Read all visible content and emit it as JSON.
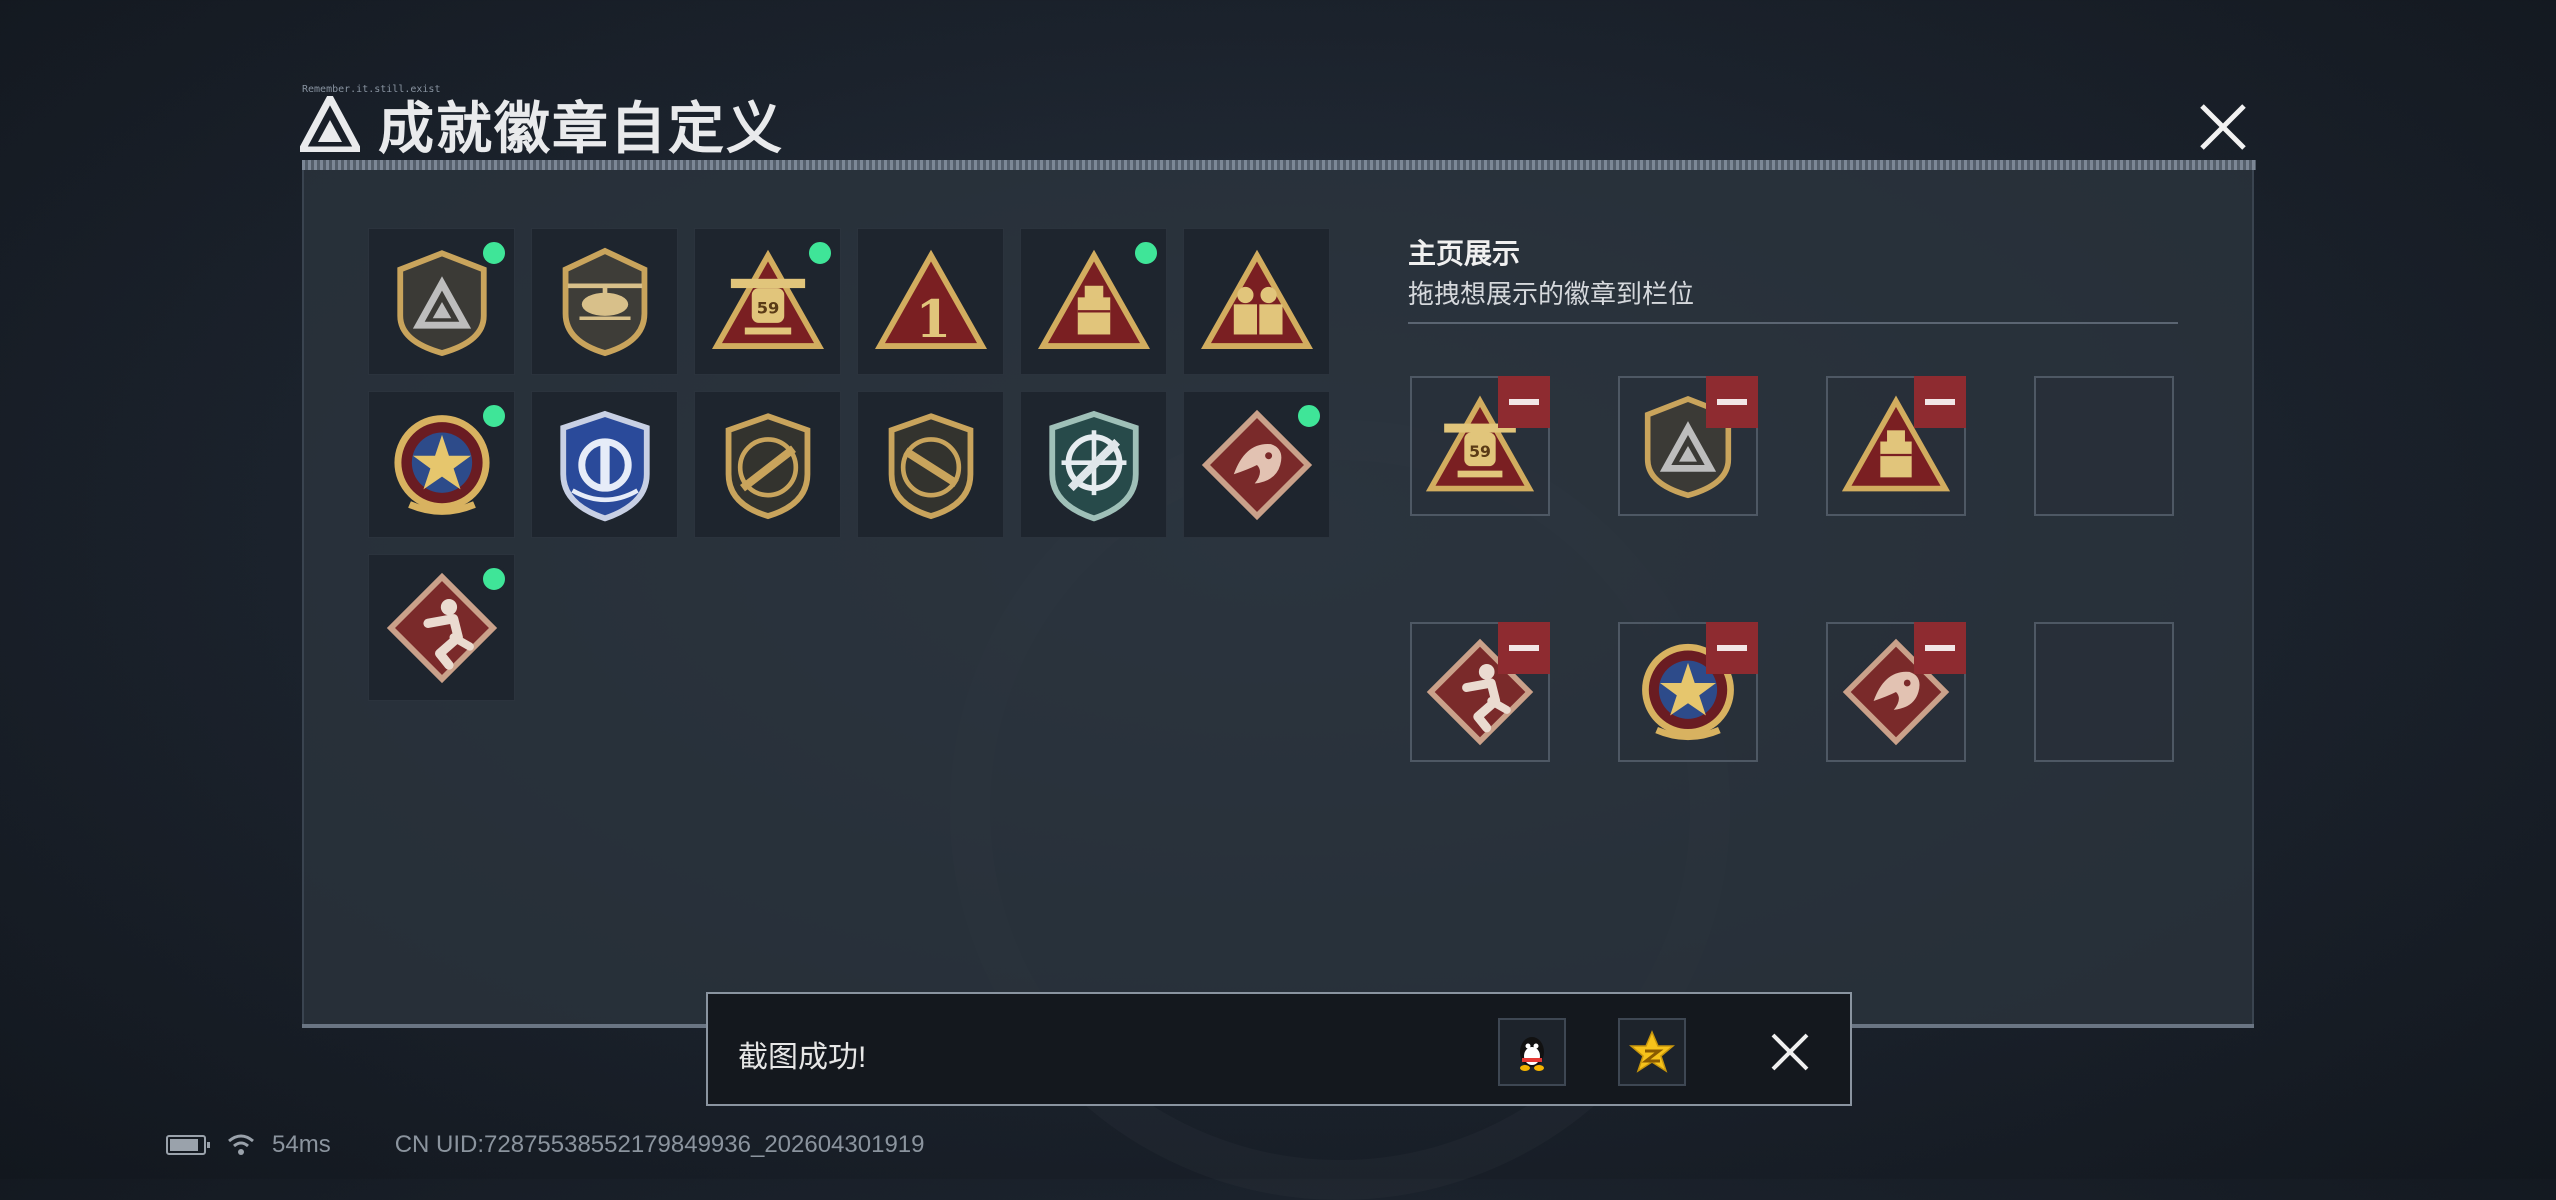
{
  "dialog": {
    "title": "成就徽章自定义",
    "micro_label": "Remember.it.still.exist"
  },
  "badges": [
    {
      "icon": "shield-logo-badge",
      "new": true
    },
    {
      "icon": "helicopter-badge",
      "new": false
    },
    {
      "icon": "gunship-59-badge",
      "new": true
    },
    {
      "icon": "number-one-triangle-badge",
      "new": false
    },
    {
      "icon": "supply-crate-triangle-badge",
      "new": true
    },
    {
      "icon": "soldiers-triangle-badge",
      "new": false
    },
    {
      "icon": "star-medal-badge",
      "new": true
    },
    {
      "icon": "blue-wing-shield-badge",
      "new": false
    },
    {
      "icon": "rifle-shield-badge",
      "new": false
    },
    {
      "icon": "rifle-shield-badge-2",
      "new": false
    },
    {
      "icon": "crosshair-knife-shield-badge",
      "new": false
    },
    {
      "icon": "dragon-diamond-badge",
      "new": true
    },
    {
      "icon": "runner-diamond-badge",
      "new": true
    }
  ],
  "showcase": {
    "title": "主页展示",
    "subtitle": "拖拽想展示的徽章到栏位",
    "slots": [
      {
        "icon": "gunship-59-badge",
        "filled": true
      },
      {
        "icon": "shield-logo-badge",
        "filled": true
      },
      {
        "icon": "supply-crate-triangle-badge",
        "filled": true
      },
      {
        "icon": "",
        "filled": false
      },
      {
        "icon": "runner-diamond-badge",
        "filled": true
      },
      {
        "icon": "star-medal-badge",
        "filled": true
      },
      {
        "icon": "dragon-diamond-badge",
        "filled": true
      },
      {
        "icon": "",
        "filled": false
      }
    ]
  },
  "toast": {
    "message": "截图成功!",
    "share_icons": [
      "qq-icon",
      "qzone-star-icon"
    ]
  },
  "status_bar": {
    "ping": "54ms",
    "uid": "CN UID:7287553855217984993​6_202604301919"
  },
  "colors": {
    "accent_green": "#3fe598",
    "remove_red": "#8e2b30",
    "gold": "#c9a45c"
  }
}
